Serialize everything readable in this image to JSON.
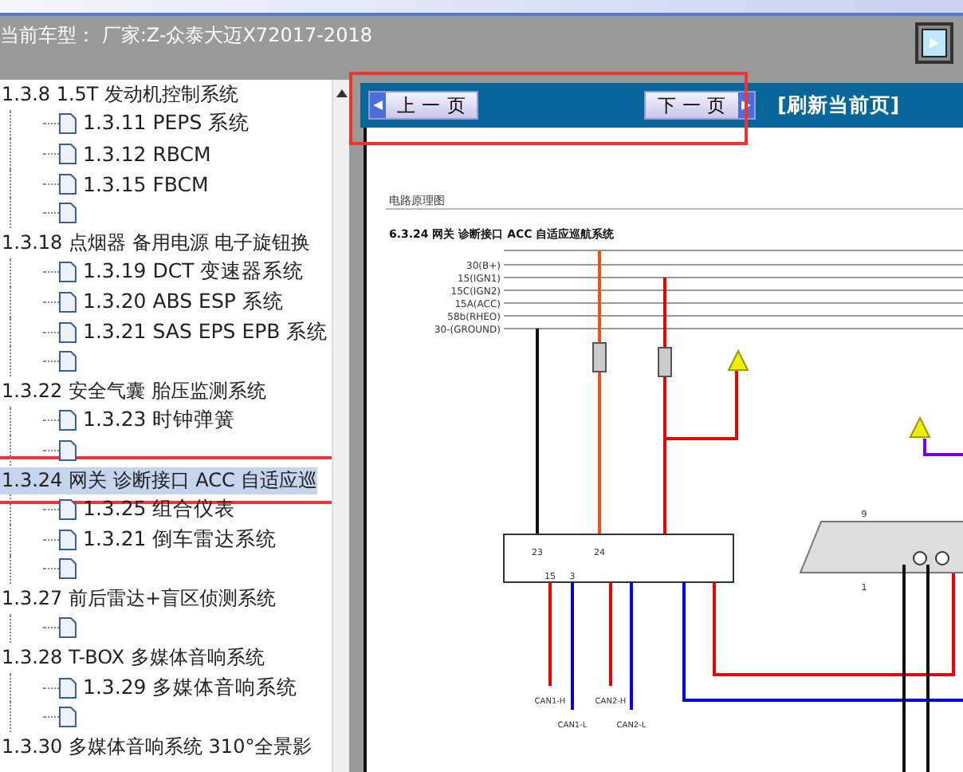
{
  "header": {
    "label": "当前车型：",
    "vehicle": "厂家:Z-众泰大迈X72017-2018"
  },
  "tree": [
    {
      "label": "1.3.8 1.5T 发动机控制系统",
      "selected": false,
      "highlighted": false,
      "children": [
        {
          "kind": "page",
          "label": "1.3.11 PEPS 系统"
        },
        {
          "kind": "page",
          "label": "1.3.12 RBCM"
        },
        {
          "kind": "page",
          "label": "1.3.15 FBCM"
        },
        {
          "kind": "page"
        }
      ]
    },
    {
      "label": "1.3.18 点烟器 备用电源 电子旋钮换",
      "selected": false,
      "highlighted": false,
      "children": [
        {
          "kind": "page",
          "label": "1.3.19 DCT 变速器系统"
        },
        {
          "kind": "page",
          "label": "1.3.20 ABS ESP 系统"
        },
        {
          "kind": "page",
          "label": "1.3.21 SAS EPS EPB 系统"
        },
        {
          "kind": "page"
        }
      ]
    },
    {
      "label": "1.3.22 安全气囊 胎压监测系统",
      "selected": false,
      "highlighted": false,
      "children": [
        {
          "kind": "page",
          "label": "1.3.23 时钟弹簧"
        },
        {
          "kind": "page"
        }
      ]
    },
    {
      "label": "1.3.24 网关 诊断接口 ACC 自适应巡",
      "selected": true,
      "highlighted": true,
      "children": [
        {
          "kind": "page",
          "label": "1.3.25 组合仪表"
        },
        {
          "kind": "page",
          "label": "1.3.21 倒车雷达系统"
        },
        {
          "kind": "page"
        }
      ]
    },
    {
      "label": "1.3.27 前后雷达+盲区侦测系统",
      "selected": false,
      "highlighted": false,
      "children": [
        {
          "kind": "page"
        }
      ]
    },
    {
      "label": "1.3.28 T-BOX 多媒体音响系统",
      "selected": false,
      "highlighted": false,
      "children": [
        {
          "kind": "page",
          "label": "1.3.29 多媒体音响系统"
        },
        {
          "kind": "page"
        }
      ]
    },
    {
      "label": "1.3.30 多媒体音响系统 310°全景影",
      "selected": false,
      "highlighted": false
    }
  ],
  "nav": {
    "prev": "上 一 页",
    "next": "下 一 页",
    "refresh": "[刷新当前页]",
    "highlighted": true
  },
  "document": {
    "section": "电路原理图",
    "title": "6.3.24 网关 诊断接口 ACC 自适应巡航系统",
    "rails": [
      "30(B+)",
      "15(IGN1)",
      "15C(IGN2)",
      "15A(ACC)",
      "58b(RHEO)",
      "30-(GROUND)"
    ],
    "pins": [
      "23",
      "24",
      "15",
      "3",
      "9",
      "1"
    ],
    "terminals": [
      "CAN1-H",
      "CAN1-L",
      "CAN2-H",
      "CAN2-L"
    ]
  }
}
